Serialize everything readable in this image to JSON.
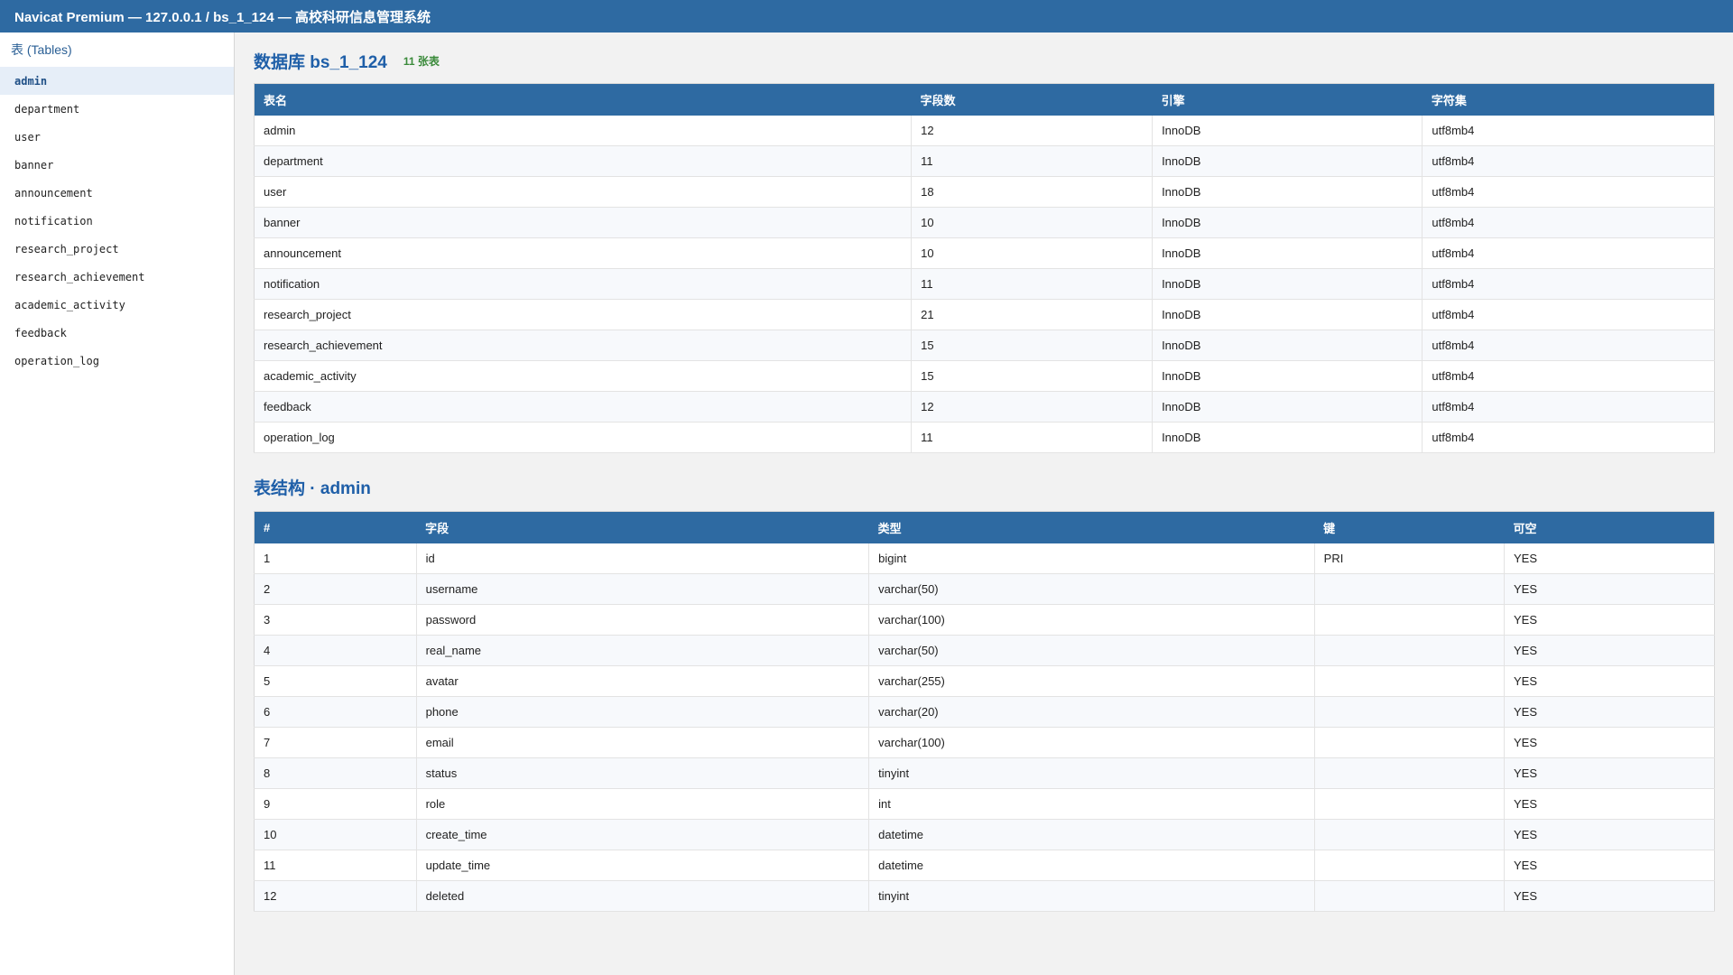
{
  "window": {
    "title": "Navicat Premium — 127.0.0.1 / bs_1_124 — 高校科研信息管理系统"
  },
  "sidebar": {
    "header": "表 (Tables)",
    "items": [
      "admin",
      "department",
      "user",
      "banner",
      "announcement",
      "notification",
      "research_project",
      "research_achievement",
      "academic_activity",
      "feedback",
      "operation_log"
    ],
    "active": "admin"
  },
  "database": {
    "title": "数据库 bs_1_124",
    "badge": "11 张表",
    "columns": [
      "表名",
      "字段数",
      "引擎",
      "字符集"
    ],
    "rows": [
      [
        "admin",
        "12",
        "InnoDB",
        "utf8mb4"
      ],
      [
        "department",
        "11",
        "InnoDB",
        "utf8mb4"
      ],
      [
        "user",
        "18",
        "InnoDB",
        "utf8mb4"
      ],
      [
        "banner",
        "10",
        "InnoDB",
        "utf8mb4"
      ],
      [
        "announcement",
        "10",
        "InnoDB",
        "utf8mb4"
      ],
      [
        "notification",
        "11",
        "InnoDB",
        "utf8mb4"
      ],
      [
        "research_project",
        "21",
        "InnoDB",
        "utf8mb4"
      ],
      [
        "research_achievement",
        "15",
        "InnoDB",
        "utf8mb4"
      ],
      [
        "academic_activity",
        "15",
        "InnoDB",
        "utf8mb4"
      ],
      [
        "feedback",
        "12",
        "InnoDB",
        "utf8mb4"
      ],
      [
        "operation_log",
        "11",
        "InnoDB",
        "utf8mb4"
      ]
    ]
  },
  "structure": {
    "title": "表结构 · admin",
    "columns": [
      "#",
      "字段",
      "类型",
      "键",
      "可空"
    ],
    "rows": [
      [
        "1",
        "id",
        "bigint",
        "PRI",
        "YES"
      ],
      [
        "2",
        "username",
        "varchar(50)",
        "",
        "YES"
      ],
      [
        "3",
        "password",
        "varchar(100)",
        "",
        "YES"
      ],
      [
        "4",
        "real_name",
        "varchar(50)",
        "",
        "YES"
      ],
      [
        "5",
        "avatar",
        "varchar(255)",
        "",
        "YES"
      ],
      [
        "6",
        "phone",
        "varchar(20)",
        "",
        "YES"
      ],
      [
        "7",
        "email",
        "varchar(100)",
        "",
        "YES"
      ],
      [
        "8",
        "status",
        "tinyint",
        "",
        "YES"
      ],
      [
        "9",
        "role",
        "int",
        "",
        "YES"
      ],
      [
        "10",
        "create_time",
        "datetime",
        "",
        "YES"
      ],
      [
        "11",
        "update_time",
        "datetime",
        "",
        "YES"
      ],
      [
        "12",
        "deleted",
        "tinyint",
        "",
        "YES"
      ]
    ]
  },
  "colors": {
    "accent": "#2e6aa2",
    "heading": "#1f5fa8",
    "badge": "#3a8a3a"
  }
}
